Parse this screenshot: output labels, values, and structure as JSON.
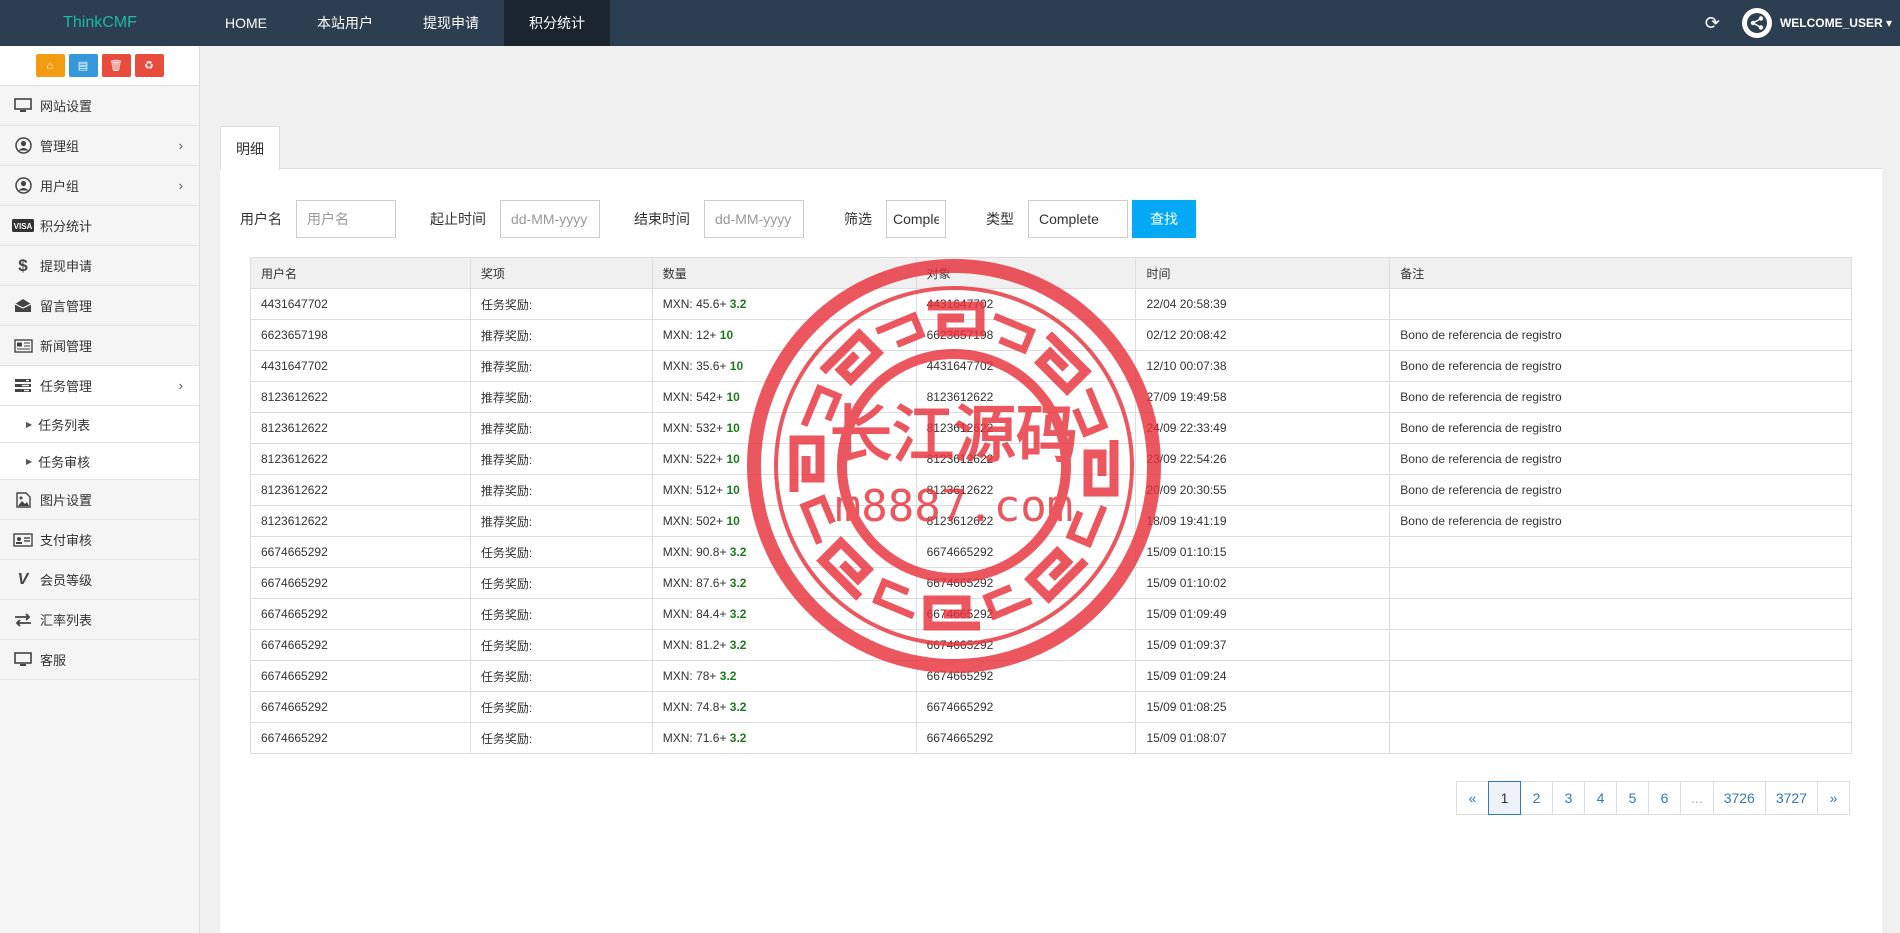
{
  "brand": "ThinkCMF",
  "nav": [
    {
      "label": "HOME",
      "active": false
    },
    {
      "label": "本站用户",
      "active": false
    },
    {
      "label": "提现申请",
      "active": false
    },
    {
      "label": "积分统计",
      "active": true
    }
  ],
  "user": {
    "welcome": "WELCOME_USER"
  },
  "sidebar": {
    "shortcuts": [
      {
        "icon": "home-icon",
        "color": "#f39c12"
      },
      {
        "icon": "file-icon",
        "color": "#3498db"
      },
      {
        "icon": "trash-icon",
        "color": "#e74c3c"
      },
      {
        "icon": "recycle-icon",
        "color": "#e74c3c"
      }
    ],
    "items": [
      {
        "label": "网站设置",
        "icon": "monitor-icon"
      },
      {
        "label": "管理组",
        "icon": "user-circle-icon",
        "arrow": true
      },
      {
        "label": "用户组",
        "icon": "user-circle-icon",
        "arrow": true
      },
      {
        "label": "积分统计",
        "icon": "visa-icon"
      },
      {
        "label": "提现申请",
        "icon": "dollar-icon"
      },
      {
        "label": "留言管理",
        "icon": "envelope-icon"
      },
      {
        "label": "新闻管理",
        "icon": "newspaper-icon"
      },
      {
        "label": "任务管理",
        "icon": "tasks-icon",
        "arrow": true
      },
      {
        "label": "图片设置",
        "icon": "image-icon"
      },
      {
        "label": "支付审核",
        "icon": "id-card-icon"
      },
      {
        "label": "会员等级",
        "icon": "vine-icon"
      },
      {
        "label": "汇率列表",
        "icon": "exchange-icon"
      },
      {
        "label": "客服",
        "icon": "monitor-icon"
      }
    ],
    "subitems": [
      "任务列表",
      "任务审核"
    ]
  },
  "tab": "明细",
  "filter": {
    "username_label": "用户名",
    "username_placeholder": "用户名",
    "start_label": "起止时间",
    "start_placeholder": "dd-MM-yyyy",
    "end_label": "结束时间",
    "end_placeholder": "dd-MM-yyyy",
    "filter_label": "筛选",
    "filter_value": "Complete",
    "type_label": "类型",
    "type_value": "Complete",
    "search_label": "查找"
  },
  "table": {
    "headers": [
      "用户名",
      "奖项",
      "数量",
      "对象",
      "时间",
      "备注"
    ],
    "rows": [
      [
        "4431647702",
        "任务奖励:",
        "MXN: 45.6+",
        "3.2",
        "4431647702",
        "22/04 20:58:39",
        ""
      ],
      [
        "6623657198",
        "推荐奖励:",
        "MXN: 12+",
        "10",
        "6623657198",
        "02/12 20:08:42",
        "Bono de referencia de registro"
      ],
      [
        "4431647702",
        "推荐奖励:",
        "MXN: 35.6+",
        "10",
        "4431647702",
        "12/10 00:07:38",
        "Bono de referencia de registro"
      ],
      [
        "8123612622",
        "推荐奖励:",
        "MXN: 542+",
        "10",
        "8123612622",
        "27/09 19:49:58",
        "Bono de referencia de registro"
      ],
      [
        "8123612622",
        "推荐奖励:",
        "MXN: 532+",
        "10",
        "8123612622",
        "24/09 22:33:49",
        "Bono de referencia de registro"
      ],
      [
        "8123612622",
        "推荐奖励:",
        "MXN: 522+",
        "10",
        "8123612622",
        "23/09 22:54:26",
        "Bono de referencia de registro"
      ],
      [
        "8123612622",
        "推荐奖励:",
        "MXN: 512+",
        "10",
        "8123612622",
        "20/09 20:30:55",
        "Bono de referencia de registro"
      ],
      [
        "8123612622",
        "推荐奖励:",
        "MXN: 502+",
        "10",
        "8123612622",
        "18/09 19:41:19",
        "Bono de referencia de registro"
      ],
      [
        "6674665292",
        "任务奖励:",
        "MXN: 90.8+",
        "3.2",
        "6674665292",
        "15/09 01:10:15",
        ""
      ],
      [
        "6674665292",
        "任务奖励:",
        "MXN: 87.6+",
        "3.2",
        "6674665292",
        "15/09 01:10:02",
        ""
      ],
      [
        "6674665292",
        "任务奖励:",
        "MXN: 84.4+",
        "3.2",
        "6674665292",
        "15/09 01:09:49",
        ""
      ],
      [
        "6674665292",
        "任务奖励:",
        "MXN: 81.2+",
        "3.2",
        "6674665292",
        "15/09 01:09:37",
        ""
      ],
      [
        "6674665292",
        "任务奖励:",
        "MXN: 78+",
        "3.2",
        "6674665292",
        "15/09 01:09:24",
        ""
      ],
      [
        "6674665292",
        "任务奖励:",
        "MXN: 74.8+",
        "3.2",
        "6674665292",
        "15/09 01:08:25",
        ""
      ],
      [
        "6674665292",
        "任务奖励:",
        "MXN: 71.6+",
        "3.2",
        "6674665292",
        "15/09 01:08:07",
        ""
      ]
    ]
  },
  "pagination": [
    "«",
    "1",
    "2",
    "3",
    "4",
    "5",
    "6",
    "...",
    "3726",
    "3727",
    "»"
  ],
  "pagination_active": "1",
  "watermark": {
    "title": "长江源码",
    "url": "m8887.com",
    "color": "#e8323c"
  }
}
